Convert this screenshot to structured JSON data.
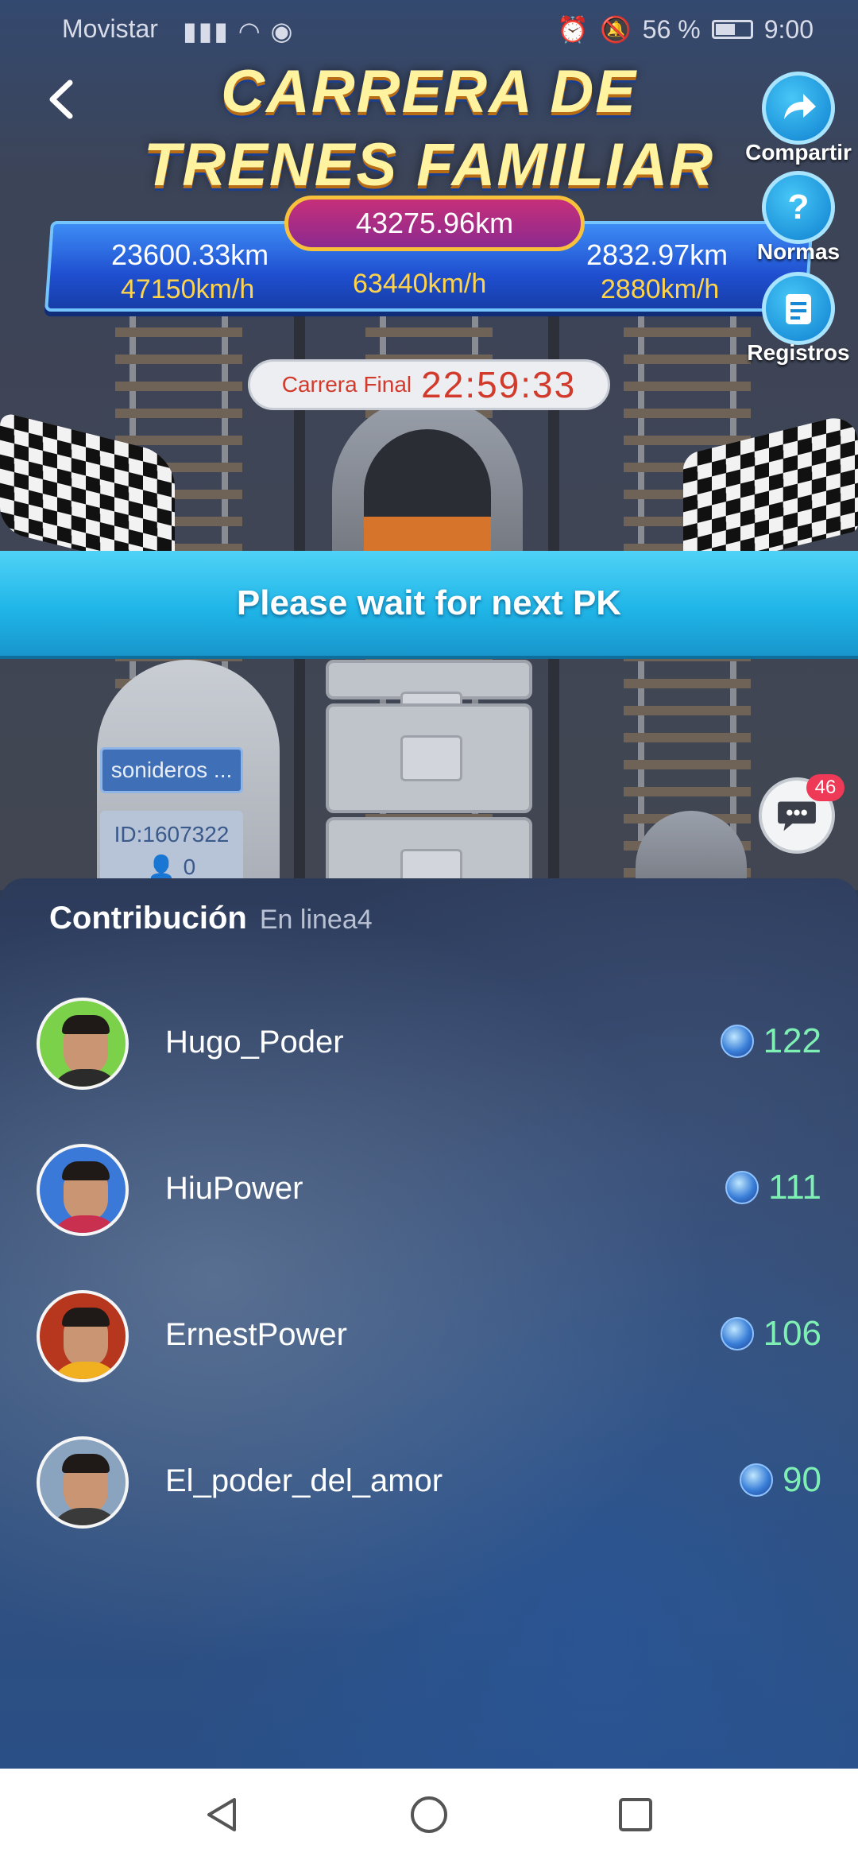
{
  "status_bar": {
    "carrier": "Movistar",
    "battery": "56 %",
    "time": "9:00"
  },
  "header": {
    "title_line1": "CARRERA DE",
    "title_line2": "TRENES FAMILIAR",
    "back_icon": "chevron-left-icon"
  },
  "scoreboard": {
    "center_distance": "43275.96km",
    "left_distance": "23600.33km",
    "left_speed": "47150km/h",
    "center_speed": "63440km/h",
    "right_distance": "2832.97km",
    "right_speed": "2880km/h"
  },
  "timer": {
    "label": "Carrera Final",
    "value": "22:59:33"
  },
  "side_actions": {
    "share": "Compartir",
    "rules": "Normas",
    "records": "Registros"
  },
  "banner": {
    "text": "Please wait for next PK"
  },
  "user_train": {
    "name": "sonideros ...",
    "id": "ID:1607322",
    "count": "0"
  },
  "chat": {
    "badge": "46",
    "icon": "chat-bubble-icon"
  },
  "contribution": {
    "title": "Contribución",
    "online": "En linea4",
    "rows": [
      {
        "name": "Hugo_Poder",
        "score": "122",
        "avatar_bg": "#7bd24a"
      },
      {
        "name": "HiuPower",
        "score": "111",
        "avatar_bg": "#3a79d8"
      },
      {
        "name": "ErnestPower",
        "score": "106",
        "avatar_bg": "#b6361e"
      },
      {
        "name": "El_poder_del_amor",
        "score": "90",
        "avatar_bg": "#8aa3bf"
      }
    ]
  },
  "navbar": {
    "back": "triangle-back-icon",
    "home": "circle-home-icon",
    "recents": "square-recents-icon"
  },
  "colors": {
    "score_green": "#7ff0b4",
    "banner_blue": "#20b6e8",
    "timer_red": "#d23a2c",
    "speed_yellow": "#ffd34a"
  }
}
